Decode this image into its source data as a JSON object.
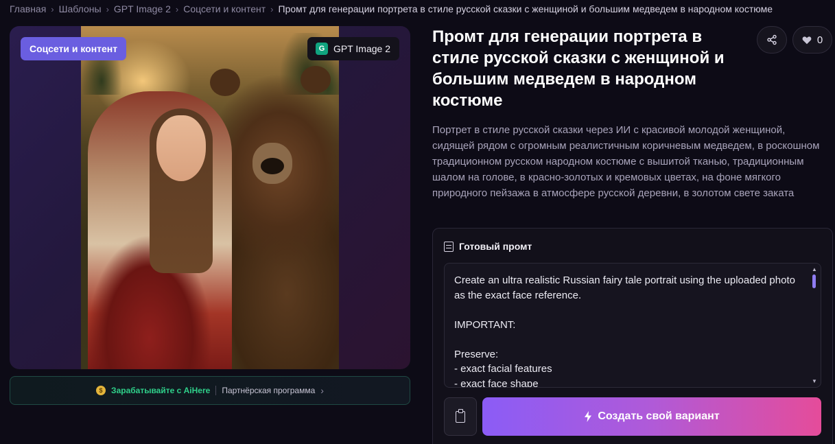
{
  "breadcrumb": {
    "items": [
      "Главная",
      "Шаблоны",
      "GPT Image 2",
      "Соцсети и контент"
    ],
    "current": "Промт для генерации портрета в стиле русской сказки с женщиной и большим медведем в народном костюме",
    "separator": "›"
  },
  "image_card": {
    "category_badge": "Соцсети и контент",
    "model_badge": "GPT Image 2",
    "model_logo_letter": "G",
    "model_logo_color": "#10a37f"
  },
  "affiliate": {
    "coin_icon": "coin-icon",
    "earn_label": "Зарабатывайте с AiHere",
    "program_label": "Партнёрская программа",
    "chevron": "›"
  },
  "header": {
    "title": "Промт для генерации портрета в стиле русской сказки с женщиной и большим медведем в народном костюме",
    "like_count": "0",
    "share_icon": "share-icon",
    "heart_icon": "heart-icon"
  },
  "description": "Портрет в стиле русской сказки через ИИ с красивой молодой женщиной, сидящей рядом с огромным реалистичным коричневым медведем, в роскошном традиционном русском народном костюме с вышитой тканью, традиционным шалом на голове, в красно-золотых и кремовых цветах, на фоне мягкого природного пейзажа в атмосфере русской деревни, в золотом свете заката",
  "prompt": {
    "header_label": "Готовый промт",
    "text": "Create an ultra realistic Russian fairy tale portrait using the uploaded photo as the exact face reference.\n\nIMPORTANT:\n\nPreserve:\n- exact facial features\n- exact face shape",
    "create_button_label": "Создать свой вариант"
  },
  "colors": {
    "accent_purple": "#6a5ee0",
    "gradient_start": "#8b5cf6",
    "gradient_end": "#e54c9a",
    "earn_green": "#2fd08a",
    "background": "#0d0b16"
  }
}
